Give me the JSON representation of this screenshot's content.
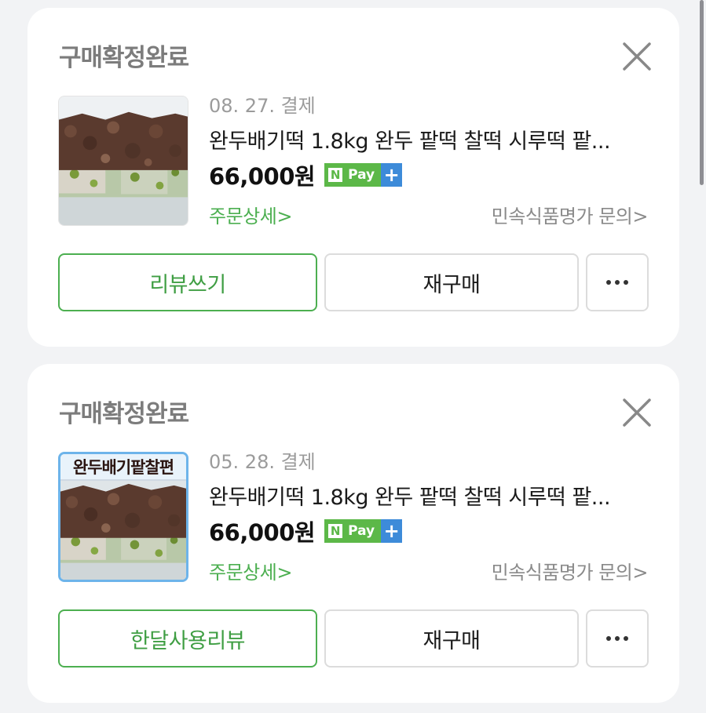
{
  "orders": [
    {
      "status": "구매확정완료",
      "date": "08. 27. 결제",
      "product_title": "완두배기떡 1.8kg 완두 팥떡 찰떡 시루떡 팥...",
      "price": "66,000원",
      "thumbnail_banner": "",
      "order_detail_label": "주문상세>",
      "seller_contact_label": "민속식품명가 문의>",
      "review_button_label": "리뷰쓰기",
      "rebuy_button_label": "재구매"
    },
    {
      "status": "구매확정완료",
      "date": "05. 28. 결제",
      "product_title": "완두배기떡 1.8kg 완두 팥떡 찰떡 시루떡 팥...",
      "price": "66,000원",
      "thumbnail_banner": "완두배기팥찰편",
      "order_detail_label": "주문상세>",
      "seller_contact_label": "민속식품명가 문의>",
      "review_button_label": "한달사용리뷰",
      "rebuy_button_label": "재구매"
    }
  ],
  "npay": {
    "n": "N",
    "pay": "Pay",
    "plus": "+"
  },
  "colors": {
    "accent_green": "#4caf50",
    "npay_green": "#5cb848",
    "npay_blue": "#3d8bd9"
  },
  "icons": [
    "close-icon",
    "more-icon",
    "npay-logo"
  ]
}
